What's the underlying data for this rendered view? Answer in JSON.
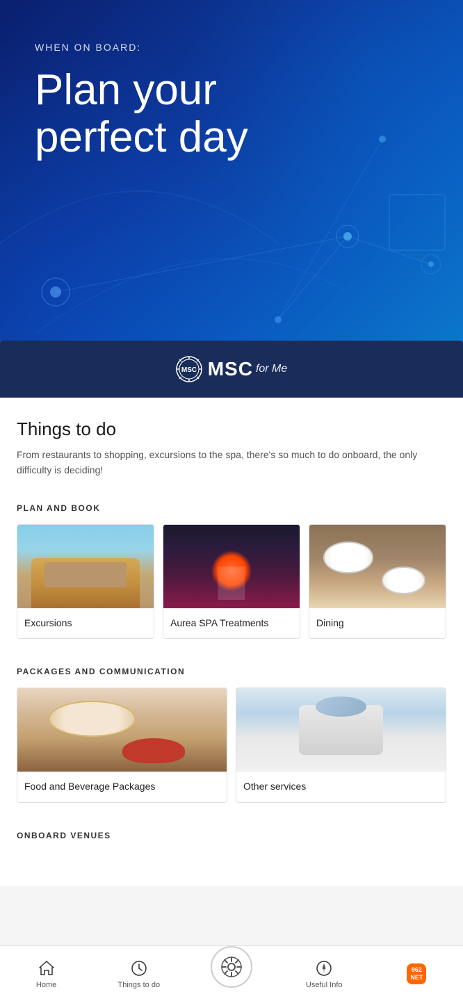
{
  "hero": {
    "label": "WHEN ON BOARD:",
    "title_line1": "Plan your",
    "title_line2": "perfect day"
  },
  "brand": {
    "name": "MSC",
    "tagline": "for Me"
  },
  "things_to_do": {
    "heading": "Things to do",
    "description": "From restaurants to shopping, excursions to the spa, there's so much to do onboard, the only difficulty is deciding!"
  },
  "plan_and_book": {
    "label": "PLAN AND BOOK",
    "items": [
      {
        "id": "excursions",
        "label": "Excursions"
      },
      {
        "id": "spa",
        "label": "Aurea SPA Treatments"
      },
      {
        "id": "dining",
        "label": "Dining"
      }
    ]
  },
  "packages": {
    "label": "PACKAGES AND COMMUNICATION",
    "items": [
      {
        "id": "food-bev",
        "label": "Food and Beverage Packages"
      },
      {
        "id": "other",
        "label": "Other services"
      }
    ]
  },
  "onboard": {
    "label": "ONBOARD VENUES"
  },
  "bottom_nav": {
    "items": [
      {
        "id": "home",
        "label": "Home",
        "icon": "🏠"
      },
      {
        "id": "things",
        "label": "Things to do",
        "icon": "🕐"
      },
      {
        "id": "helm",
        "label": "",
        "icon": "⚙"
      },
      {
        "id": "info",
        "label": "Useful Info",
        "icon": "🧭"
      },
      {
        "id": "watermark",
        "label": "",
        "icon": ""
      }
    ]
  }
}
